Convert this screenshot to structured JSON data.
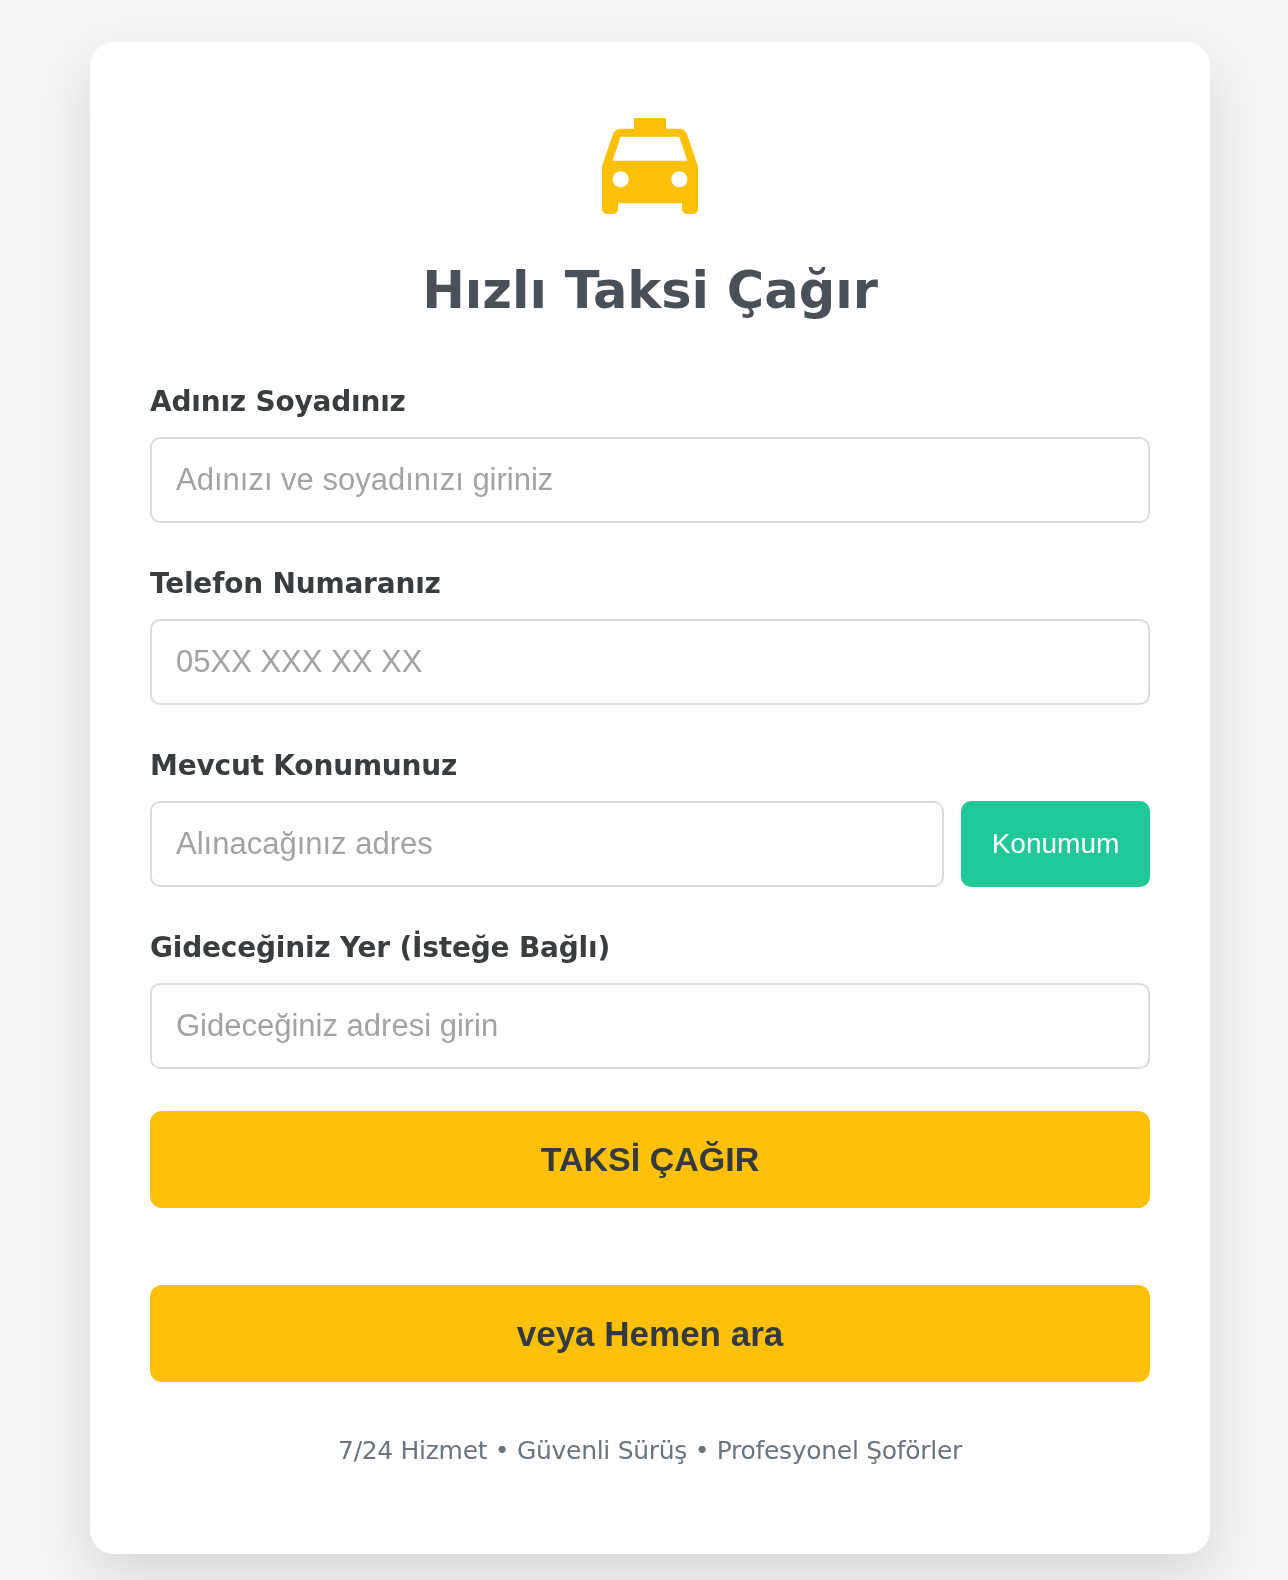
{
  "header": {
    "title": "Hızlı Taksi Çağır"
  },
  "fields": [
    {
      "kind": "text",
      "label": "Adınız Soyadınız",
      "placeholder": "Adınızı ve soyadınızı giriniz"
    },
    {
      "kind": "text",
      "label": "Telefon Numaranız",
      "placeholder": "05XX XXX XX XX"
    },
    {
      "kind": "location",
      "label": "Mevcut Konumunuz",
      "placeholder": "Alınacağınız adres",
      "button": "Konumum"
    },
    {
      "kind": "text",
      "label": "Gideceğiniz Yer (İsteğe Bağlı)",
      "placeholder": "Gideceğiniz adresi girin"
    }
  ],
  "actions": [
    "TAKSİ ÇAĞIR",
    "veya Hemen ara"
  ],
  "footer": "7/24 Hizmet • Güvenli Sürüş • Profesyonel Şoförler"
}
